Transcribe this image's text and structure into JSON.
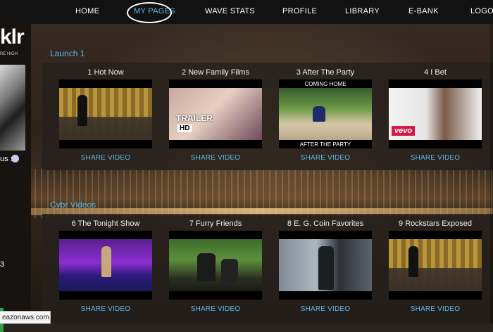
{
  "nav": {
    "items": [
      {
        "label": "HOME",
        "active": false
      },
      {
        "label": "MY PAGES",
        "active": true
      },
      {
        "label": "WAVE STATS",
        "active": false
      },
      {
        "label": "PROFILE",
        "active": false
      },
      {
        "label": "LIBRARY",
        "active": false
      },
      {
        "label": "E-BANK",
        "active": false
      },
      {
        "label": "LOGO",
        "active": false
      }
    ]
  },
  "sidebar": {
    "logo_text": "klr",
    "logo_sub": "RE HIGH",
    "status_label": "us :",
    "number": "3"
  },
  "sections": [
    {
      "title": "Launch 1",
      "videos": [
        {
          "title": "1 Hot Now",
          "share_label": "SHARE VIDEO",
          "thumb": "curtain-stage"
        },
        {
          "title": "2 New Family Films",
          "share_label": "SHARE VIDEO",
          "thumb": "trailer",
          "overlay_top": "TRAILER",
          "overlay_badge": "HD"
        },
        {
          "title": "3 After The Party",
          "share_label": "SHARE VIDEO",
          "thumb": "party",
          "overlay_top": "COMING HOME",
          "overlay_bottom": "AFTER THE PARTY"
        },
        {
          "title": "4 I Bet",
          "share_label": "SHARE VIDEO",
          "thumb": "vevo",
          "overlay_badge": "vevo"
        }
      ]
    },
    {
      "title": "Cybr Videos",
      "videos": [
        {
          "title": "6 The Tonight Show",
          "share_label": "SHARE VIDEO",
          "thumb": "stage"
        },
        {
          "title": "7 Furry Friends",
          "share_label": "SHARE VIDEO",
          "thumb": "gorilla"
        },
        {
          "title": "8 E. G. Coin Favorites",
          "share_label": "SHARE VIDEO",
          "thumb": "office"
        },
        {
          "title": "9 Rockstars Exposed",
          "share_label": "SHARE VIDEO",
          "thumb": "curtain-stage"
        }
      ]
    }
  ],
  "statusbar": {
    "text": "eazonaws.com..."
  },
  "colors": {
    "accent": "#5cb7e6",
    "nav_bg": "#121212",
    "vevo": "#d6174a"
  }
}
